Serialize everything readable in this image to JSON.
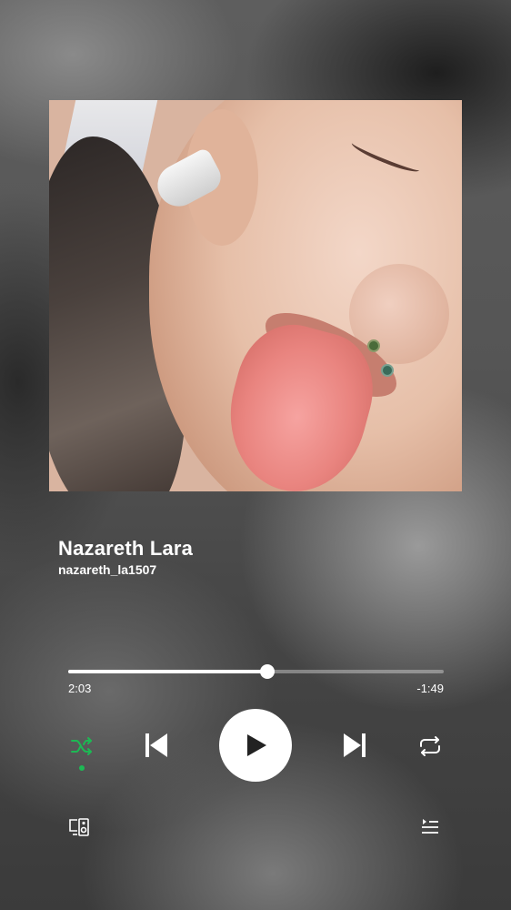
{
  "track": {
    "title": "Nazareth Lara",
    "artist": "nazareth_la1507"
  },
  "playback": {
    "elapsed": "2:03",
    "remaining": "-1:49",
    "progress_fraction": 0.53,
    "shuffle_active": true,
    "is_playing": false
  },
  "icons": {
    "shuffle": "shuffle-icon",
    "previous": "skip-previous-icon",
    "play": "play-icon",
    "next": "skip-next-icon",
    "repeat": "repeat-icon",
    "devices": "devices-icon",
    "queue": "queue-icon"
  },
  "colors": {
    "accent": "#1db954",
    "text": "#ffffff"
  }
}
